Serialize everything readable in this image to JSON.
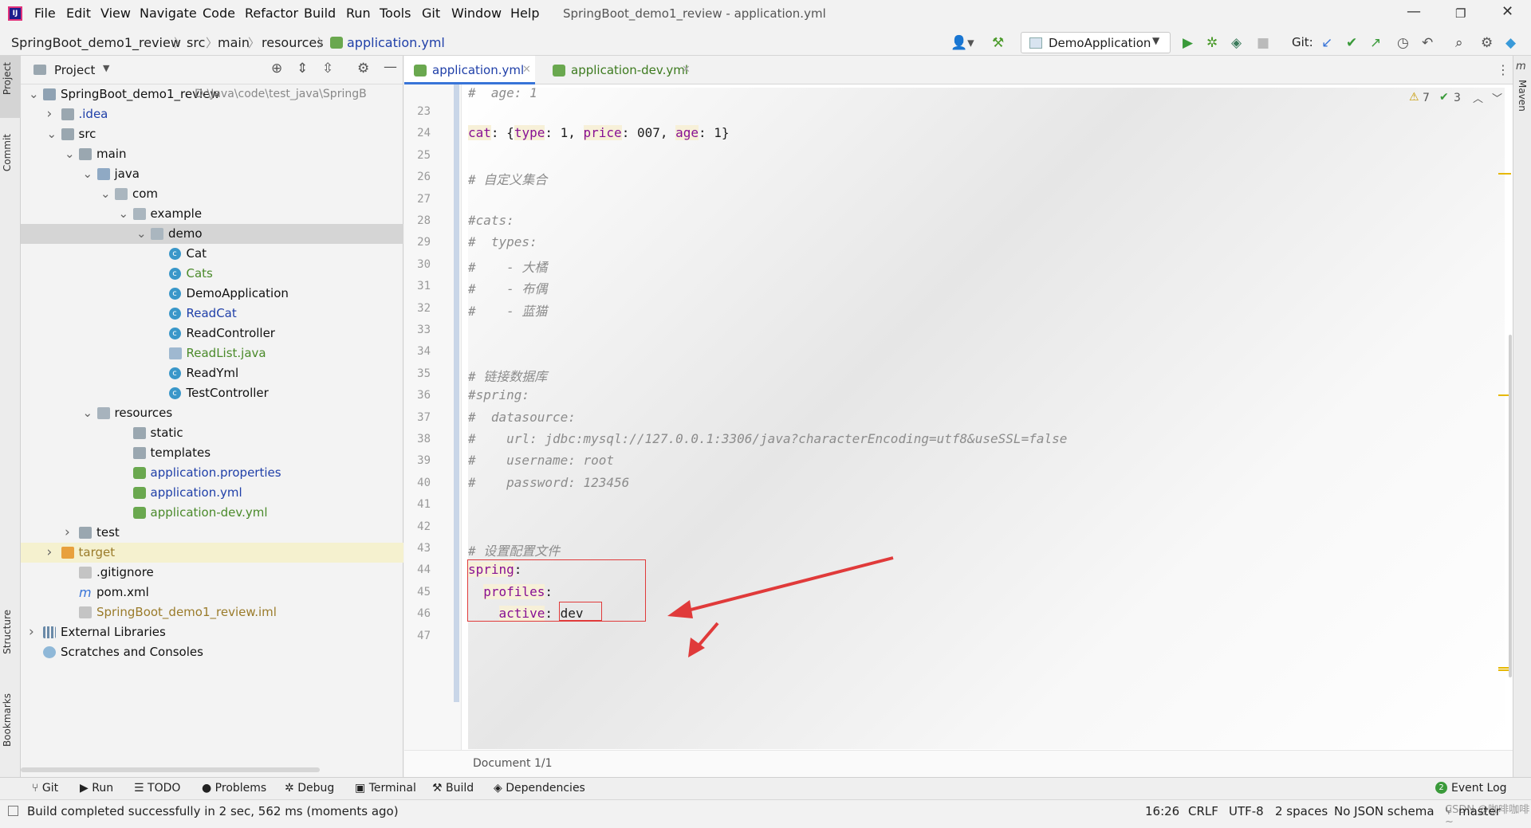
{
  "menubar": {
    "items": [
      "File",
      "Edit",
      "View",
      "Navigate",
      "Code",
      "Refactor",
      "Build",
      "Run",
      "Tools",
      "Git",
      "Window",
      "Help"
    ],
    "title": "SpringBoot_demo1_review - application.yml"
  },
  "navbar": {
    "crumbs": [
      "SpringBoot_demo1_review",
      "src",
      "main",
      "resources",
      "application.yml"
    ],
    "run_config": "DemoApplication",
    "git_label": "Git:"
  },
  "left_strip": {
    "project": "Project",
    "commit": "Commit",
    "structure": "Structure",
    "bookmarks": "Bookmarks"
  },
  "right_strip": {
    "maven": "Maven"
  },
  "project_panel": {
    "title": "Project",
    "tree": [
      {
        "label": "SpringBoot_demo1_review",
        "path": "D:\\Java\\code\\test_java\\SpringB",
        "indent": 0,
        "open": true,
        "icon": "module-folder",
        "color": "#111"
      },
      {
        "label": ".idea",
        "indent": 1,
        "open": false,
        "icon": "folder",
        "color": "#1f3fa8"
      },
      {
        "label": "src",
        "indent": 1,
        "open": true,
        "icon": "folder",
        "color": "#111"
      },
      {
        "label": "main",
        "indent": 2,
        "open": true,
        "icon": "folder",
        "color": "#111"
      },
      {
        "label": "java",
        "indent": 3,
        "open": true,
        "icon": "folder-src",
        "color": "#111"
      },
      {
        "label": "com",
        "indent": 4,
        "open": true,
        "icon": "package",
        "color": "#111"
      },
      {
        "label": "example",
        "indent": 5,
        "open": true,
        "icon": "package",
        "color": "#111"
      },
      {
        "label": "demo",
        "indent": 6,
        "open": true,
        "icon": "package",
        "color": "#111",
        "selected": true
      },
      {
        "label": "Cat",
        "indent": 7,
        "icon": "class",
        "color": "#111"
      },
      {
        "label": "Cats",
        "indent": 7,
        "icon": "class",
        "color": "#4a8a2a"
      },
      {
        "label": "DemoApplication",
        "indent": 7,
        "icon": "class-run",
        "color": "#111"
      },
      {
        "label": "ReadCat",
        "indent": 7,
        "icon": "class",
        "color": "#1f3fa8"
      },
      {
        "label": "ReadController",
        "indent": 7,
        "icon": "class",
        "color": "#111"
      },
      {
        "label": "ReadList.java",
        "indent": 7,
        "icon": "java-file",
        "color": "#4a8a2a"
      },
      {
        "label": "ReadYml",
        "indent": 7,
        "icon": "class",
        "color": "#111"
      },
      {
        "label": "TestController",
        "indent": 7,
        "icon": "class",
        "color": "#111"
      },
      {
        "label": "resources",
        "indent": 3,
        "open": true,
        "icon": "folder-res",
        "color": "#111"
      },
      {
        "label": "static",
        "indent": 5,
        "icon": "folder",
        "color": "#111"
      },
      {
        "label": "templates",
        "indent": 5,
        "icon": "folder",
        "color": "#111"
      },
      {
        "label": "application.properties",
        "indent": 5,
        "icon": "yml",
        "color": "#1f3fa8"
      },
      {
        "label": "application.yml",
        "indent": 5,
        "icon": "yml",
        "color": "#1f3fa8"
      },
      {
        "label": "application-dev.yml",
        "indent": 5,
        "icon": "yml",
        "color": "#4a8a2a"
      },
      {
        "label": "test",
        "indent": 2,
        "open": false,
        "icon": "folder",
        "color": "#111"
      },
      {
        "label": "target",
        "indent": 1,
        "open": false,
        "icon": "folder-orange",
        "color": "#9a7b2a",
        "highlight": true
      },
      {
        "label": ".gitignore",
        "indent": 2,
        "icon": "file",
        "color": "#111"
      },
      {
        "label": "pom.xml",
        "indent": 2,
        "icon": "maven",
        "color": "#111"
      },
      {
        "label": "SpringBoot_demo1_review.iml",
        "indent": 2,
        "icon": "file",
        "color": "#9a7b2a"
      },
      {
        "label": "External Libraries",
        "indent": 0,
        "open": false,
        "icon": "libs",
        "color": "#111"
      },
      {
        "label": "Scratches and Consoles",
        "indent": 0,
        "icon": "scratch",
        "color": "#111"
      }
    ]
  },
  "editor": {
    "tabs": [
      {
        "label": "application.yml",
        "active": true
      },
      {
        "label": "application-dev.yml",
        "active": false
      }
    ],
    "inspection": {
      "warnings": "7",
      "weak": "3"
    },
    "lines": [
      {
        "n": "23",
        "text": ""
      },
      {
        "n": "24",
        "html": "cat"
      },
      {
        "n": "25",
        "text": ""
      },
      {
        "n": "26",
        "comment": "# 自定义集合"
      },
      {
        "n": "27",
        "text": ""
      },
      {
        "n": "28",
        "comment": "#cats:"
      },
      {
        "n": "29",
        "comment": "#  types:"
      },
      {
        "n": "30",
        "comment": "#    - 大橘"
      },
      {
        "n": "31",
        "comment": "#    - 布偶"
      },
      {
        "n": "32",
        "comment": "#    - 蓝猫"
      },
      {
        "n": "33",
        "text": ""
      },
      {
        "n": "34",
        "text": ""
      },
      {
        "n": "35",
        "comment": "# 链接数据库"
      },
      {
        "n": "36",
        "comment": "#spring:"
      },
      {
        "n": "37",
        "comment": "#  datasource:"
      },
      {
        "n": "38",
        "comment": "#    url: jdbc:mysql://127.0.0.1:3306/java?characterEncoding=utf8&useSSL=false"
      },
      {
        "n": "39",
        "comment": "#    username: root"
      },
      {
        "n": "40",
        "comment": "#    password: 123456"
      },
      {
        "n": "41",
        "text": ""
      },
      {
        "n": "42",
        "text": ""
      },
      {
        "n": "43",
        "comment": "# 设置配置文件"
      },
      {
        "n": "44",
        "html": "spring"
      },
      {
        "n": "45",
        "html": "profiles"
      },
      {
        "n": "46",
        "html": "active"
      },
      {
        "n": "47",
        "text": ""
      }
    ],
    "top_partial": "#  age: 1",
    "cat_line": {
      "key": "cat",
      "type_key": "type",
      "type_val": "1",
      "price_key": "price",
      "price_val": "007",
      "age_key": "age",
      "age_val": "1"
    },
    "spring_key": "spring",
    "profiles_key": "profiles",
    "active_key": "active",
    "active_val": "dev",
    "doc_breadcrumb": "Document 1/1"
  },
  "bottom_toolbar": [
    "Git",
    "Run",
    "TODO",
    "Problems",
    "Debug",
    "Terminal",
    "Build",
    "Dependencies"
  ],
  "event_log": "Event Log",
  "event_count": "2",
  "status": {
    "message": "Build completed successfully in 2 sec, 562 ms (moments ago)",
    "position": "16:26",
    "line_sep": "CRLF",
    "encoding": "UTF-8",
    "indent": "2 spaces",
    "schema": "No JSON schema",
    "branch": "master",
    "watermark": "CSDN @咖啡咖啡~"
  },
  "colors": {
    "accent": "#3874d8",
    "annotation": "#e03a3a",
    "key": "#871094",
    "comment": "#8c8c8c"
  }
}
